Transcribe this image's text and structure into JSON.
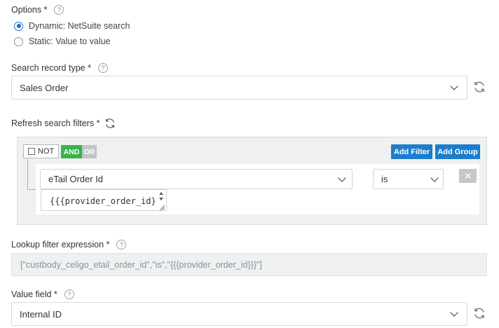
{
  "options": {
    "label": "Options *",
    "radios": [
      {
        "label": "Dynamic: NetSuite search",
        "checked": true
      },
      {
        "label": "Static: Value to value",
        "checked": false
      }
    ]
  },
  "search_record_type": {
    "label": "Search record type *",
    "value": "Sales Order"
  },
  "refresh_filters": {
    "label": "Refresh search filters *",
    "not_label": "NOT",
    "and_label": "AND",
    "or_label": "OR",
    "add_filter_label": "Add Filter",
    "add_group_label": "Add Group",
    "filter_field": "eTail Order Id",
    "operator": "is",
    "value_text": "{{{provider_order_id}}}"
  },
  "lookup_filter": {
    "label": "Lookup filter expression *",
    "value": "[\"custbody_celigo_etail_order_id\",\"is\",\"{{{provider_order_id}}}\"]"
  },
  "value_field": {
    "label": "Value field *",
    "value": "Internal ID"
  },
  "icons": {
    "help": "?",
    "close": "✕"
  },
  "colors": {
    "accent": "#1b7dcc",
    "and_green": "#3cb34a",
    "or_gray": "#b9bec1"
  }
}
